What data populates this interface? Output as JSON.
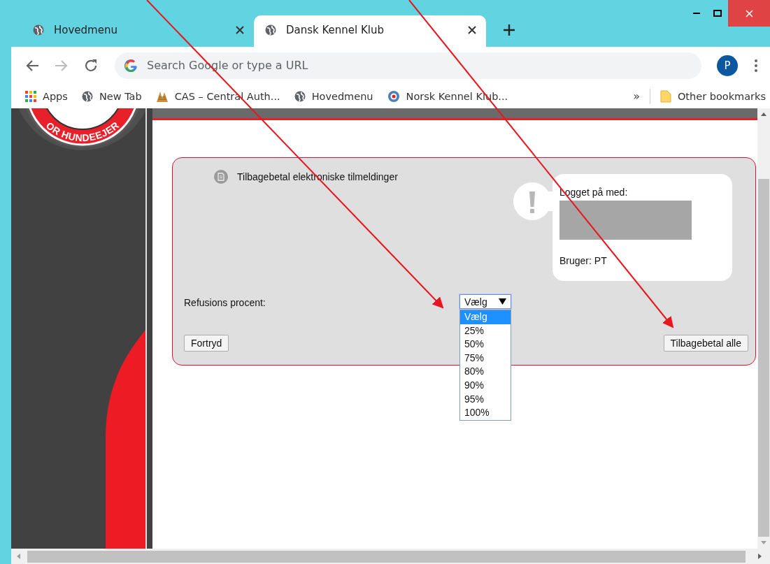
{
  "browser": {
    "tabs": [
      {
        "title": "Hovedmenu",
        "selected": false
      },
      {
        "title": "Dansk Kennel Klub",
        "selected": true
      }
    ],
    "address_bar": {
      "placeholder": "Search Google or type a URL"
    },
    "profile_initial": "P",
    "bookmarks": [
      {
        "label": "Apps",
        "kind": "apps"
      },
      {
        "label": "New Tab",
        "kind": "globe"
      },
      {
        "label": "CAS – Central Auth...",
        "kind": "cas"
      },
      {
        "label": "Hovedmenu",
        "kind": "globe"
      },
      {
        "label": "Norsk Kennel Klub...",
        "kind": "nkk"
      }
    ],
    "overflow": "»",
    "other_bookmarks": "Other bookmarks"
  },
  "sidebar": {
    "logo_text": "OR HUNDEEJER"
  },
  "panel": {
    "title": "Tilbagebetal elektroniske tilmeldinger",
    "login_info": {
      "heading": "Logget på med:",
      "user": "Bruger: PT"
    },
    "refund_label": "Refusions procent:",
    "select": {
      "value": "Vælg",
      "expanded": true,
      "options": [
        {
          "label": "Vælg",
          "selected": true
        },
        {
          "label": "25%",
          "selected": false
        },
        {
          "label": "50%",
          "selected": false
        },
        {
          "label": "75%",
          "selected": false
        },
        {
          "label": "80%",
          "selected": false
        },
        {
          "label": "90%",
          "selected": false
        },
        {
          "label": "95%",
          "selected": false
        },
        {
          "label": "100%",
          "selected": false
        }
      ]
    },
    "buttons": [
      {
        "label": "Fortryd"
      },
      {
        "label": "Tilbagebetal alle"
      }
    ]
  }
}
